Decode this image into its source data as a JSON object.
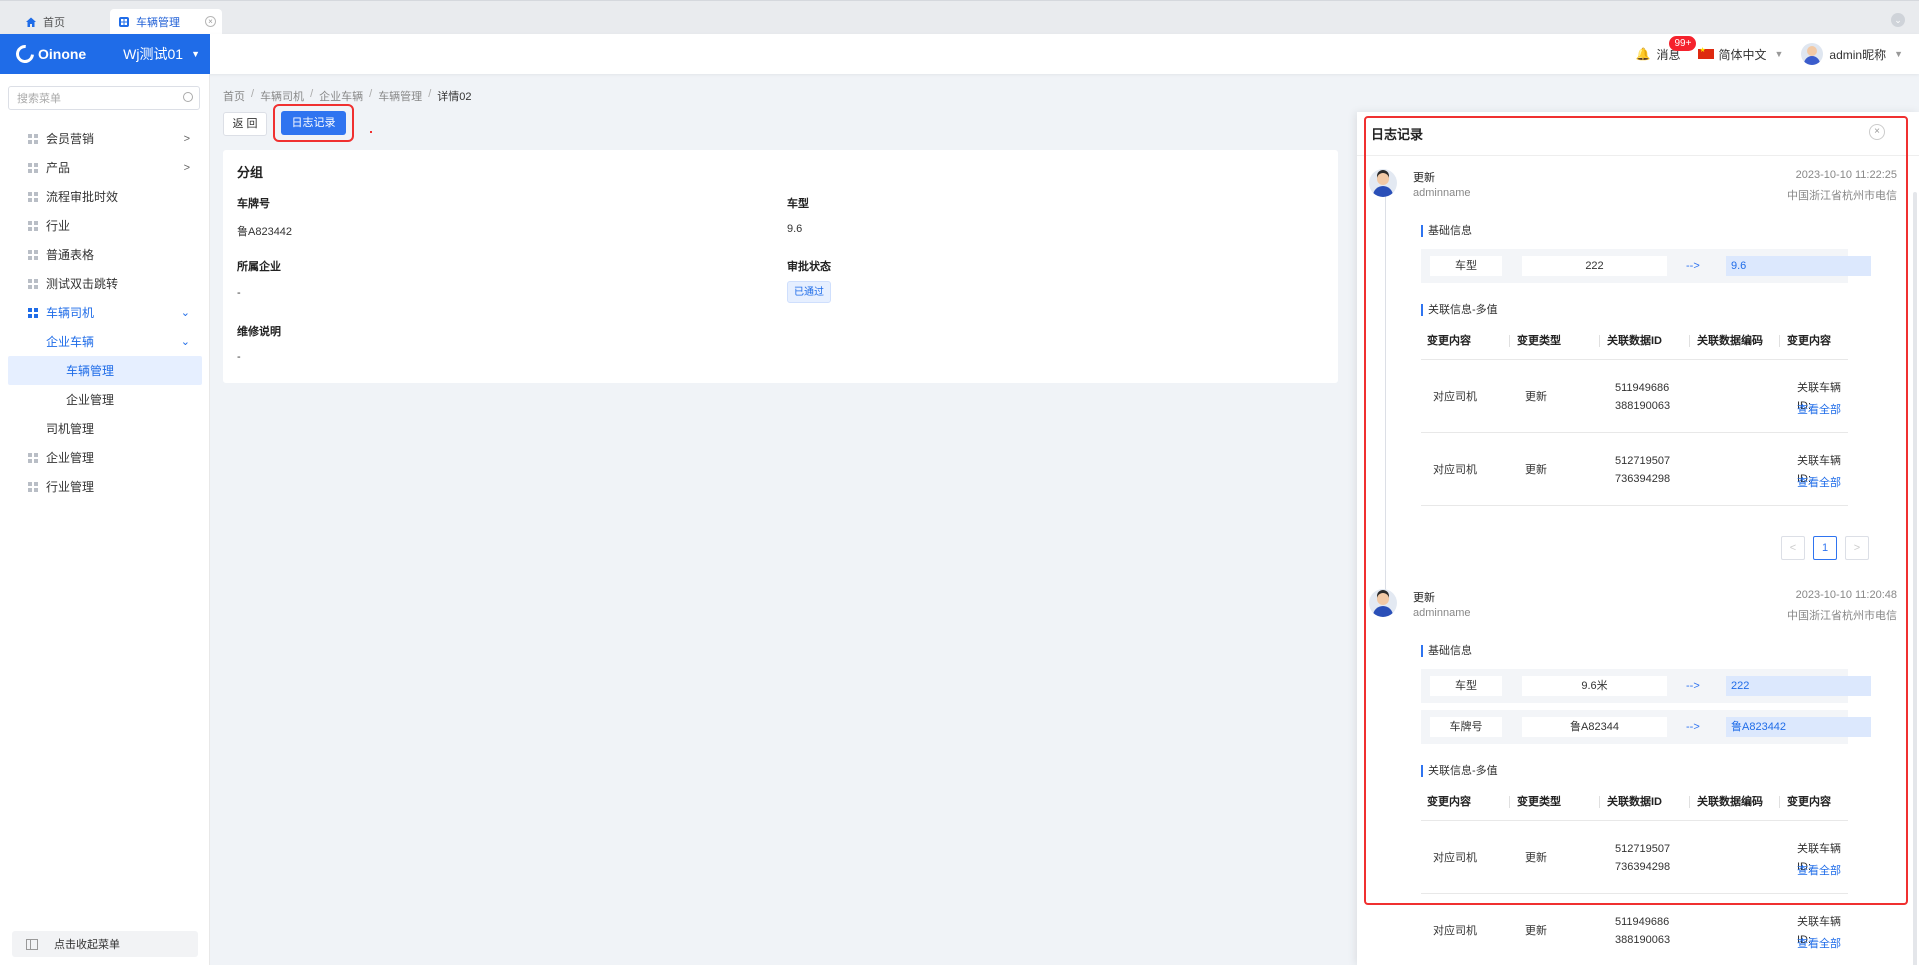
{
  "browser_tabs": {
    "home": "首页",
    "active": "车辆管理"
  },
  "header": {
    "brand": "Oinone",
    "app_name": "Wj测试01",
    "messages": "消息",
    "message_badge": "99+",
    "language": "简体中文",
    "user": "admin昵称"
  },
  "sidebar": {
    "search_placeholder": "搜索菜单",
    "items": [
      {
        "label": "会员营销"
      },
      {
        "label": "产品"
      },
      {
        "label": "流程审批时效"
      },
      {
        "label": "行业"
      },
      {
        "label": "普通表格"
      },
      {
        "label": "测试双击跳转"
      },
      {
        "label": "车辆司机"
      },
      {
        "label": "企业车辆"
      },
      {
        "label": "车辆管理"
      },
      {
        "label": "企业管理"
      },
      {
        "label": "司机管理"
      },
      {
        "label": "企业管理"
      },
      {
        "label": "行业管理"
      }
    ],
    "collapse_label": "点击收起菜单"
  },
  "breadcrumb": [
    "首页",
    "车辆司机",
    "企业车辆",
    "车辆管理",
    "详情02"
  ],
  "toolbar": {
    "back_label": "返 回",
    "log_label": "日志记录"
  },
  "detail": {
    "group_title": "分组",
    "fields": {
      "plate_label": "车牌号",
      "plate_value": "鲁A823442",
      "type_label": "车型",
      "type_value": "9.6",
      "company_label": "所属企业",
      "company_value": "-",
      "audit_label": "审批状态",
      "audit_value": "已通过",
      "repair_label": "维修说明",
      "repair_value": "-"
    }
  },
  "log_drawer": {
    "title": "日志记录",
    "basic_info_title": "基础信息",
    "relation_title": "关联信息-多值",
    "columns": [
      "变更内容",
      "变更类型",
      "关联数据ID",
      "关联数据编码",
      "变更内容"
    ],
    "arrow": "-->",
    "view_all": "查看全部",
    "related_vehicle_label": "关联车辆ID:",
    "entries": [
      {
        "action": "更新",
        "user": "adminname",
        "time": "2023-10-10 11:22:25",
        "location": "中国浙江省杭州市电信",
        "diffs": [
          {
            "field": "车型",
            "old": "222",
            "new": "9.6"
          }
        ],
        "rows": [
          {
            "content": "对应司机",
            "type": "更新",
            "id_line1": "511949686",
            "id_line2": "388190063"
          },
          {
            "content": "对应司机",
            "type": "更新",
            "id_line1": "512719507",
            "id_line2": "736394298"
          }
        ],
        "page": "1"
      },
      {
        "action": "更新",
        "user": "adminname",
        "time": "2023-10-10 11:20:48",
        "location": "中国浙江省杭州市电信",
        "diffs": [
          {
            "field": "车型",
            "old": "9.6米",
            "new": "222"
          },
          {
            "field": "车牌号",
            "old": "鲁A82344",
            "new": "鲁A823442"
          }
        ],
        "rows": [
          {
            "content": "对应司机",
            "type": "更新",
            "id_line1": "512719507",
            "id_line2": "736394298"
          },
          {
            "content": "对应司机",
            "type": "更新",
            "id_line1": "511949686",
            "id_line2": "388190063"
          }
        ]
      }
    ]
  },
  "colors": {
    "primary": "#2f74f0",
    "brand_bg": "#1f6ce8",
    "highlight_frame": "#f03030",
    "badge": "#f5222d"
  },
  "icons": [
    "home-icon",
    "grid-icon",
    "bell-icon",
    "flag-icon",
    "search-icon",
    "close-icon",
    "chevron-icon"
  ]
}
